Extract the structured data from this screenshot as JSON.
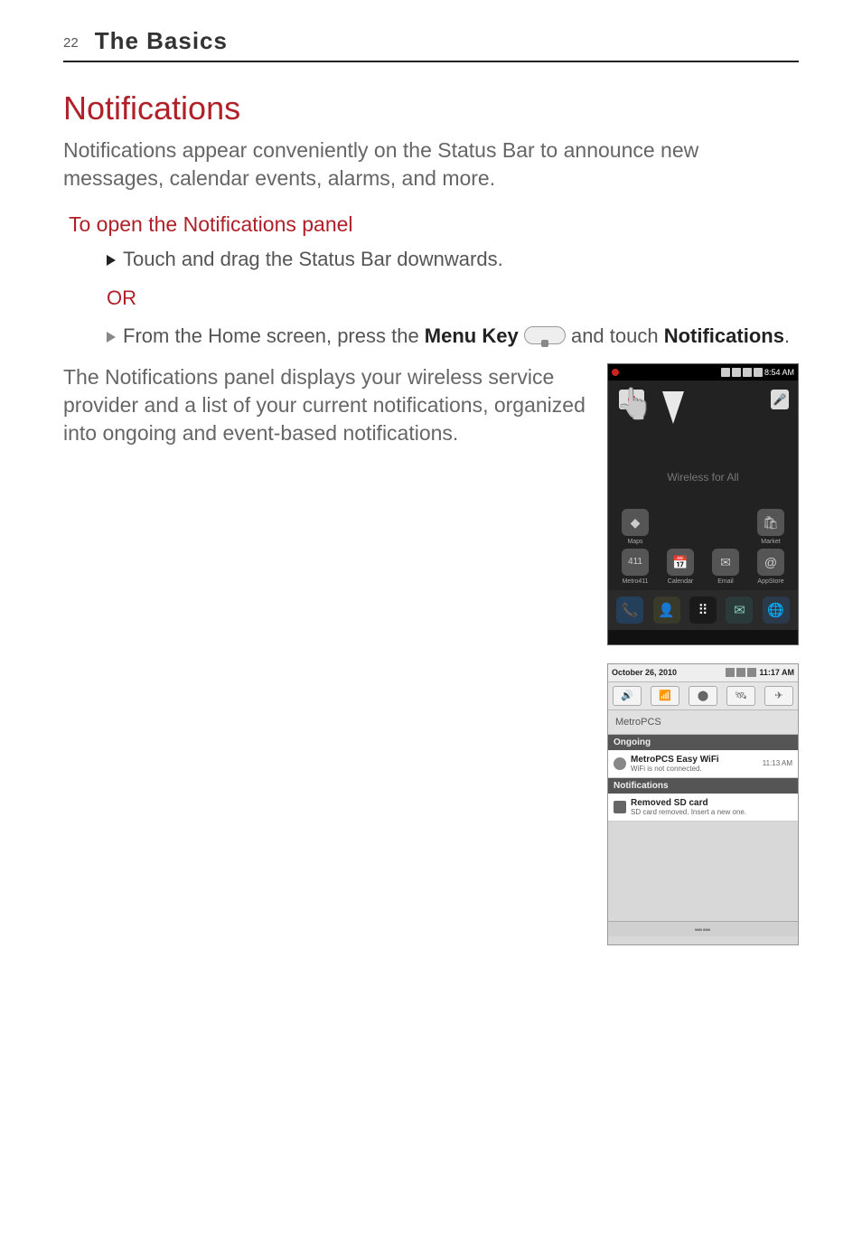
{
  "header": {
    "page_number": "22",
    "section_title": "The Basics"
  },
  "main": {
    "h1": "Notifications",
    "intro": "Notifications appear conveniently on the Status Bar to announce new messages, calendar events, alarms, and more.",
    "sub_heading": "To open the Notifications panel",
    "bullet1": "Touch and drag the Status Bar downwards.",
    "or_label": "OR",
    "bullet2_pre": "From the Home screen, press the ",
    "bullet2_menu_key": "Menu Key",
    "bullet2_post": " and touch ",
    "bullet2_notifications": "Notifications",
    "bullet2_period": ".",
    "para2": "The Notifications panel displays your wireless service provider and a list of your current notifications, organized into ongoing and event-based notifications."
  },
  "screenshot1": {
    "status_time": "8:54 AM",
    "google_g": "g",
    "mic_glyph": "🎤",
    "hand_glyph": "👆",
    "brand_line": "Wireless for All",
    "apps_row1": [
      {
        "label": "Maps",
        "glyph": "◆"
      },
      {
        "label": "",
        "glyph": ""
      },
      {
        "label": "",
        "glyph": ""
      },
      {
        "label": "Market",
        "glyph": "🛍"
      }
    ],
    "apps_row2": [
      {
        "label": "Metro411",
        "glyph": "411"
      },
      {
        "label": "Calendar",
        "glyph": "📅"
      },
      {
        "label": "Email",
        "glyph": "✉"
      },
      {
        "label": "AppStore",
        "glyph": "@"
      }
    ],
    "dock": {
      "phone": "📞",
      "contacts": "👤",
      "apps": "⠿",
      "messages": "✉",
      "browser": "🌐"
    }
  },
  "screenshot2": {
    "status_date": "October 26, 2010",
    "status_time": "11:17 AM",
    "toggles": [
      "🔊",
      "📶",
      "⬤",
      "🛰",
      "✈"
    ],
    "carrier": "MetroPCS",
    "section_ongoing": "Ongoing",
    "ongoing_items": [
      {
        "title": "MetroPCS Easy WiFi",
        "subtitle": "WiFi is not connected.",
        "time": "11:13 AM"
      }
    ],
    "section_notifications": "Notifications",
    "notif_items": [
      {
        "title": "Removed SD card",
        "subtitle": "SD card removed. Insert a new one."
      }
    ],
    "grab_glyph": "▬▬"
  }
}
